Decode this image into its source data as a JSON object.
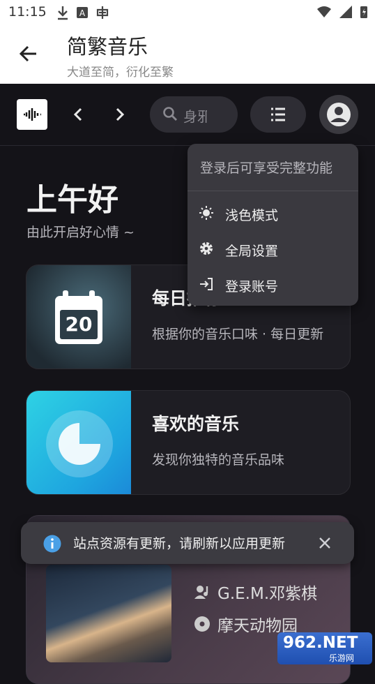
{
  "status_bar": {
    "time": "11:15"
  },
  "app_bar": {
    "title": "简繁音乐",
    "subtitle": "大道至简，衍化至繁"
  },
  "web_header": {
    "search_text": "身邪"
  },
  "greeting": {
    "title": "上午好",
    "subtitle": "由此开启好心情 ~"
  },
  "cards": [
    {
      "title": "每日推荐",
      "description": "根据你的音乐口味 · 每日更新",
      "calendar_day": "20"
    },
    {
      "title": "喜欢的音乐",
      "description": "发现你独特的音乐品味"
    }
  ],
  "now_card": {
    "artist": "G.E.M.邓紫棋",
    "album": "摩天动物园"
  },
  "dropdown_menu": {
    "header": "登录后可享受完整功能",
    "items": [
      {
        "label": "浅色模式",
        "icon": "sun-icon"
      },
      {
        "label": "全局设置",
        "icon": "gear-icon"
      },
      {
        "label": "登录账号",
        "icon": "login-icon"
      }
    ]
  },
  "toast": {
    "message": "站点资源有更新，请刷新以应用更新"
  },
  "watermark": {
    "logo_text": "962.NET",
    "site_text": "乐游网"
  },
  "colors": {
    "background": "#141318",
    "surface": "#2e2d34",
    "menu": "#3a393f",
    "cyan_accent": "#27c7e0"
  }
}
